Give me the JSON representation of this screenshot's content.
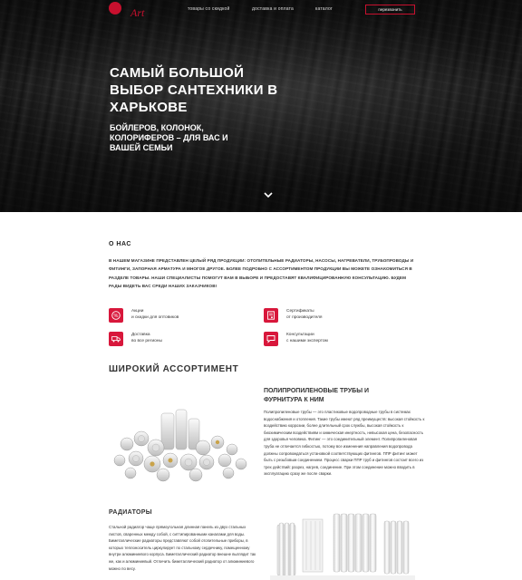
{
  "header": {
    "logo_text": "Art",
    "nav": [
      "товары со скидкой",
      "доставка и оплата",
      "каталог"
    ],
    "call_button": "перезвонить"
  },
  "hero": {
    "title": "САМЫЙ БОЛЬШОЙ ВЫБОР САНТЕХНИКИ В ХАРЬКОВЕ",
    "subtitle": "БОЙЛЕРОВ, КОЛОНОК, КОЛОРИФЕРОВ – ДЛЯ ВАС И ВАШЕЙ СЕМЬИ"
  },
  "about": {
    "title": "О НАС",
    "text": "В НАШЕМ МАГАЗИНЕ ПРЕДСТАВЛЕН ЦЕЛЫЙ РЯД ПРОДУКЦИИ: ОТОПИТЕЛЬНЫЕ РАДИАТОРЫ, НАСОСЫ, НАГРЕВАТЕЛИ, ТРУБОПРОВОДЫ И ФИТИНГИ, ЗАПОРНАЯ АРМАТУРА И МНОГОЕ ДРУГОЕ. БОЛЕЕ ПОДРОБНО С АССОРТИМЕНТОМ ПРОДУКЦИИ ВЫ МОЖЕТЕ ОЗНАКОМИТЬСЯ В РАЗДЕЛЕ ТОВАРЫ. НАШИ СПЕЦИАЛИСТЫ ПОМОГУТ ВАМ В ВЫБОРЕ И ПРЕДОСТАВЯТ КВАЛИФИЦИРОВАННУЮ КОНСУЛЬТАЦИЮ. БУДЕМ РАДЫ ВИДЕТЬ ВАС СРЕДИ НАШИХ ЗАКАЗЧИКОВ!"
  },
  "features": [
    {
      "icon": "percent-icon",
      "line1": "Акции",
      "line2": "и скидки для оптовиков"
    },
    {
      "icon": "certificate-icon",
      "line1": "Сертификаты",
      "line2": "от производителя"
    },
    {
      "icon": "truck-icon",
      "line1": "Доставка",
      "line2": "во все регионы"
    },
    {
      "icon": "chat-icon",
      "line1": "Консультации",
      "line2": "с нашими экспертом"
    }
  ],
  "range": {
    "title": "ШИРОКИЙ АССОРТИМЕНТ",
    "pipes_title": "ПОЛИПРОПИЛЕНОВЫЕ ТРУБЫ И ФУРНИТУРА К НИМ",
    "pipes_text": "Полипропиленовые трубы — это пластиковые водопроводные трубы в системах водоснабжения и отопления. Такие трубы имеют ряд преимуществ: высокая стойкость к воздействию коррозии, более длительный срок службы, высокая стойкость к биохимическим воздействиям и химическая инертность, невысокая цена, безопасность для здоровья человека. Фитинг — это соединительный элемент. Полипропиленовая труба не отличается гибкостью, потому все изменения направления водопровода должны сопровождаться установкой соответствующих фитингов. ППР фитинг может быть с резьбовым соединением. Процесс сварки ППР труб и фитингов состоит всего из трех действий: разрез, нагрев, соединение. При этом соединение можно вводить в эксплуатацию сразу же после сварки.",
    "radiators_title": "РАДИАТОРЫ",
    "radiators_text": "Стальной радиатор чаще прямоугольная длинная панель из двух стальных листов, сваренных между собой, с ситтипированными каналами для воды. Биметаллические радиаторы представляют собой отопительные приборы, в которых теплоноситель циркулирует по стальному сердечнику, помещенному внутри алюминиевого корпуса. Биметаллический радиатор внешне выглядит так же, как и алюминиевый. Отличить биметаллический радиатор от алюминиевого можно по весу."
  },
  "colors": {
    "accent": "#d8173b"
  }
}
